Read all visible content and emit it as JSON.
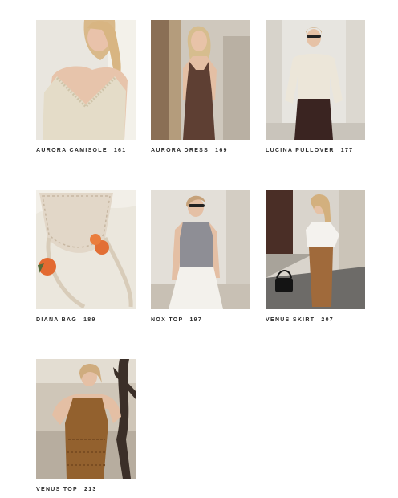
{
  "patterns": [
    {
      "name": "AURORA CAMISOLE",
      "page": "161",
      "icon": "photo-woman-cream-camisole"
    },
    {
      "name": "AURORA DRESS",
      "page": "169",
      "icon": "photo-woman-brown-dress"
    },
    {
      "name": "LUCINA PULLOVER",
      "page": "177",
      "icon": "photo-woman-cream-pullover"
    },
    {
      "name": "DIANA BAG",
      "page": "189",
      "icon": "photo-lace-bag-with-oranges"
    },
    {
      "name": "NOX TOP",
      "page": "197",
      "icon": "photo-woman-grey-top"
    },
    {
      "name": "VENUS SKIRT",
      "page": "207",
      "icon": "photo-woman-tan-skirt"
    },
    {
      "name": "VENUS TOP",
      "page": "213",
      "icon": "photo-woman-tan-top"
    }
  ]
}
